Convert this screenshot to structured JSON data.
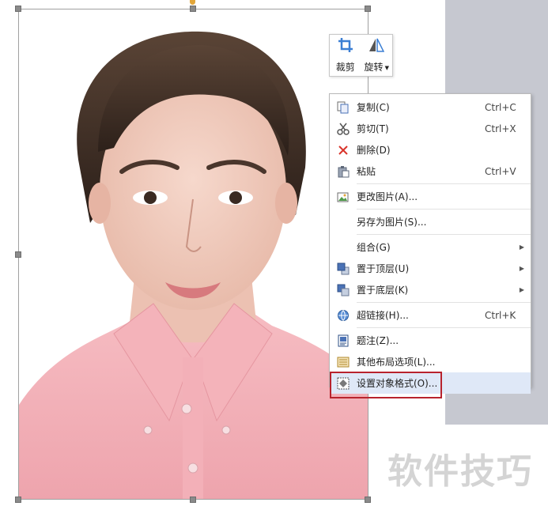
{
  "mini_toolbar": {
    "crop_label": "裁剪",
    "rotate_label": "旋转"
  },
  "context_menu": {
    "items": [
      {
        "label": "复制(C)",
        "shortcut": "Ctrl+C",
        "icon": "copy-icon"
      },
      {
        "label": "剪切(T)",
        "shortcut": "Ctrl+X",
        "icon": "cut-icon"
      },
      {
        "label": "删除(D)",
        "shortcut": "",
        "icon": "delete-icon"
      },
      {
        "label": "粘贴",
        "shortcut": "Ctrl+V",
        "icon": "paste-icon"
      },
      {
        "label": "更改图片(A)...",
        "shortcut": "",
        "icon": "change-picture-icon"
      },
      {
        "label": "另存为图片(S)...",
        "shortcut": "",
        "icon": ""
      },
      {
        "label": "组合(G)",
        "shortcut": "",
        "icon": "",
        "submenu": true
      },
      {
        "label": "置于顶层(U)",
        "shortcut": "",
        "icon": "bring-to-front-icon",
        "submenu": true
      },
      {
        "label": "置于底层(K)",
        "shortcut": "",
        "icon": "send-to-back-icon",
        "submenu": true
      },
      {
        "label": "超链接(H)...",
        "shortcut": "Ctrl+K",
        "icon": "hyperlink-icon"
      },
      {
        "label": "题注(Z)...",
        "shortcut": "",
        "icon": "caption-icon"
      },
      {
        "label": "其他布局选项(L)...",
        "shortcut": "",
        "icon": "layout-options-icon"
      },
      {
        "label": "设置对象格式(O)...",
        "shortcut": "",
        "icon": "format-object-icon",
        "highlighted": true
      }
    ]
  },
  "watermark": "软件技巧",
  "colors": {
    "accent_highlight": "#dfe8f7",
    "annotation_box": "#b8232d",
    "shirt": "#f2aeb5",
    "side_gray": "#c6c8d0"
  }
}
